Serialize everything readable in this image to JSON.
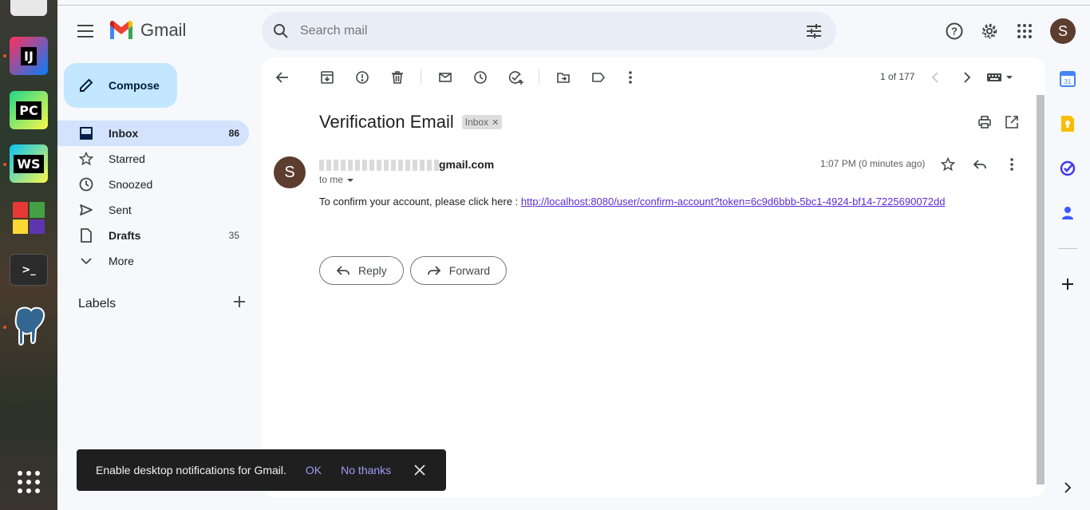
{
  "header": {
    "app_name": "Gmail",
    "search_placeholder": "Search mail"
  },
  "user": {
    "initial": "S"
  },
  "sidebar": {
    "compose_label": "Compose",
    "items": [
      {
        "label": "Inbox",
        "count": "86",
        "icon": "inbox-icon",
        "active": true
      },
      {
        "label": "Starred",
        "count": "",
        "icon": "star-icon"
      },
      {
        "label": "Snoozed",
        "count": "",
        "icon": "clock-icon"
      },
      {
        "label": "Sent",
        "count": "",
        "icon": "send-icon"
      },
      {
        "label": "Drafts",
        "count": "35",
        "icon": "draft-icon",
        "bold": true
      },
      {
        "label": "More",
        "count": "",
        "icon": "chevron-down-icon"
      }
    ],
    "labels_title": "Labels"
  },
  "toolbar": {
    "pager": "1 of 177"
  },
  "message": {
    "subject": "Verification Email",
    "tag": "Inbox",
    "sender_initial": "S",
    "sender_visible": "gmail.com",
    "to": "to me",
    "time": "1:07 PM (0 minutes ago)",
    "body_prefix": "To confirm your account, please click here : ",
    "link": "http://localhost:8080/user/confirm-account?token=6c9d6bbb-5bc1-4924-bf14-7225690072dd",
    "reply_label": "Reply",
    "forward_label": "Forward"
  },
  "snackbar": {
    "text": "Enable desktop notifications for Gmail.",
    "ok": "OK",
    "no_thanks": "No thanks"
  },
  "dock": {
    "apps": [
      {
        "label": "IJ",
        "color": "#1e88e5"
      },
      {
        "label": "PC",
        "color": "#21d789"
      },
      {
        "label": "WS",
        "color": "#07c3f2"
      },
      {
        "label": "",
        "color": "#c62828"
      },
      {
        "label": ">_",
        "color": "#333333"
      },
      {
        "label": "",
        "color": "#336791"
      }
    ]
  }
}
